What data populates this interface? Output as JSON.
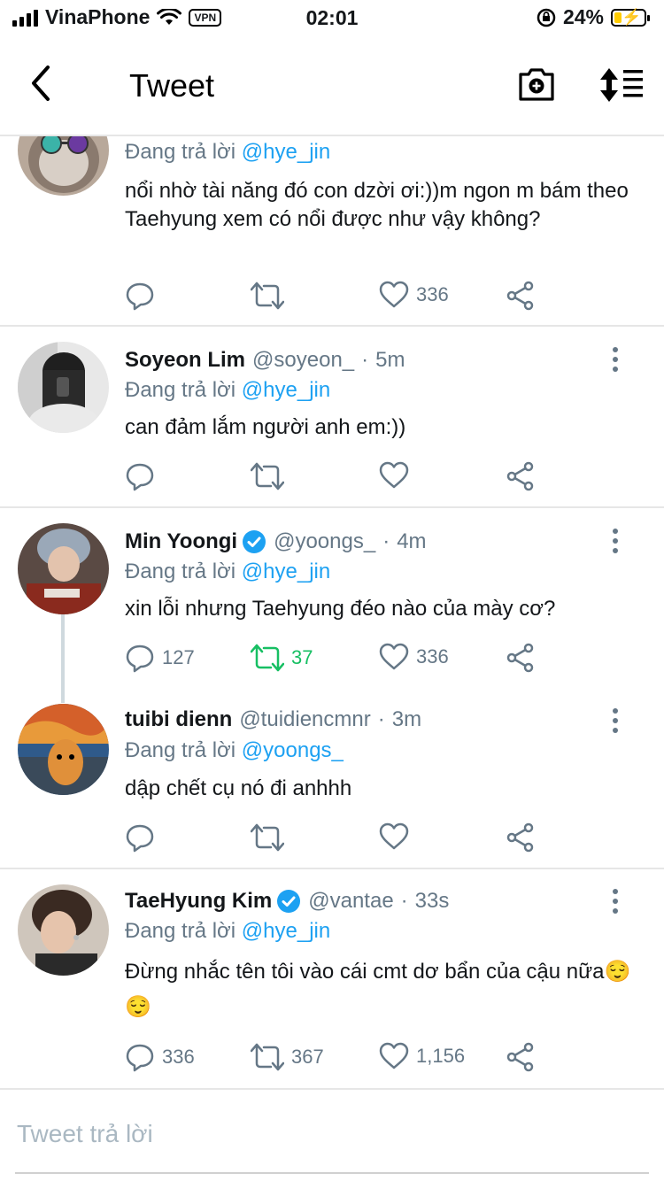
{
  "status_bar": {
    "carrier": "VinaPhone",
    "vpn": "VPN",
    "time": "02:01",
    "battery": "24%",
    "battery_level": 0.24
  },
  "header": {
    "title": "Tweet"
  },
  "tweets": [
    {
      "reply_label": "Đang trả lời",
      "reply_to": "@hye_jin",
      "text": "nổi nhờ tài năng đó con dzời ơi:))m ngon m bám theo Taehyung xem có nổi được như vậy không?",
      "replies": "",
      "retweets": "",
      "likes": "336"
    },
    {
      "name": "Soyeon Lim",
      "handle": "@soyeon_",
      "time": "5m",
      "reply_label": "Đang trả lời",
      "reply_to": "@hye_jin",
      "text": "can đảm lắm người anh em:))",
      "replies": "",
      "retweets": "",
      "likes": ""
    },
    {
      "name": "Min Yoongi",
      "handle": "@yoongs_",
      "time": "4m",
      "verified": true,
      "reply_label": "Đang trả lời",
      "reply_to": "@hye_jin",
      "text": "xin lỗi nhưng Taehyung đéo nào của mày cơ?",
      "replies": "127",
      "retweets": "37",
      "likes": "336",
      "retweeted": true
    },
    {
      "name": "tuibi dienn",
      "handle": "@tuidiencmnr",
      "time": "3m",
      "reply_label": "Đang trả lời",
      "reply_to": "@yoongs_",
      "text": "dập chết cụ nó đi anhhh",
      "replies": "",
      "retweets": "",
      "likes": ""
    },
    {
      "name": "TaeHyung Kim",
      "handle": "@vantae",
      "time": "33s",
      "verified": true,
      "reply_label": "Đang trả lời",
      "reply_to": "@hye_jin",
      "text": "Đừng nhắc tên tôi vào cái cmt dơ bẩn của cậu nữa😌😌",
      "replies": "336",
      "retweets": "367",
      "likes": "1,156"
    }
  ],
  "reply_box": {
    "placeholder": "Tweet trả lời"
  },
  "colors": {
    "link": "#1da1f2",
    "secondary_text": "#657786",
    "retweet_active": "#17bf63",
    "verified": "#1da1f2",
    "divider": "#e6e6e6"
  }
}
